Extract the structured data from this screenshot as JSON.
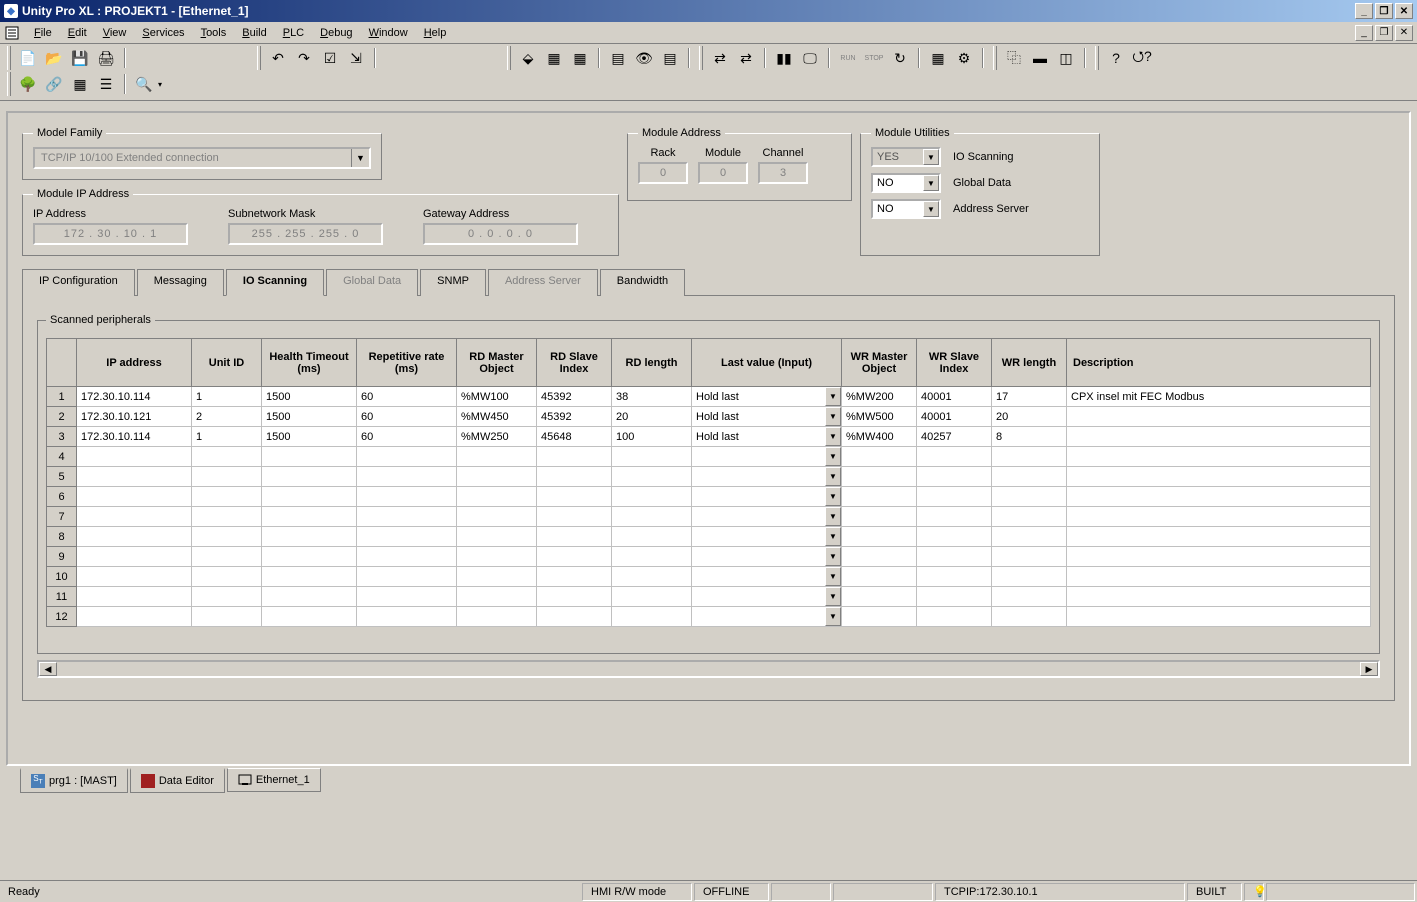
{
  "window": {
    "title": "Unity Pro XL : PROJEKT1 - [Ethernet_1]"
  },
  "menu": [
    "File",
    "Edit",
    "View",
    "Services",
    "Tools",
    "Build",
    "PLC",
    "Debug",
    "Window",
    "Help"
  ],
  "config": {
    "model_family": {
      "legend": "Model Family",
      "value": "TCP/IP 10/100 Extended connection"
    },
    "module_address": {
      "legend": "Module Address",
      "rack_label": "Rack",
      "rack": "0",
      "module_label": "Module",
      "module": "0",
      "channel_label": "Channel",
      "channel": "3"
    },
    "utilities": {
      "legend": "Module Utilities",
      "io_scanning": {
        "label": "IO Scanning",
        "value": "YES"
      },
      "global_data": {
        "label": "Global Data",
        "value": "NO"
      },
      "address_server": {
        "label": "Address Server",
        "value": "NO"
      }
    },
    "module_ip": {
      "legend": "Module IP Address",
      "ip_label": "IP Address",
      "ip": "172 . 30 . 10 . 1",
      "subnet_label": "Subnetwork Mask",
      "subnet": "255 . 255 . 255 . 0",
      "gateway_label": "Gateway Address",
      "gateway": "0 . 0 . 0 . 0"
    }
  },
  "tabs": {
    "ip_config": "IP Configuration",
    "messaging": "Messaging",
    "io_scanning": "IO Scanning",
    "global_data": "Global Data",
    "snmp": "SNMP",
    "address_server": "Address Server",
    "bandwidth": "Bandwidth"
  },
  "scan": {
    "legend": "Scanned peripherals",
    "headers": {
      "ip": "IP address",
      "unit": "Unit ID",
      "health": "Health Timeout (ms)",
      "rep": "Repetitive rate (ms)",
      "rdm": "RD Master Object",
      "rds": "RD Slave Index",
      "rdl": "RD length",
      "last": "Last value (Input)",
      "wrm": "WR Master Object",
      "wrs": "WR Slave Index",
      "wrl": "WR length",
      "desc": "Description"
    },
    "rows": [
      {
        "n": "1",
        "ip": "172.30.10.114",
        "unit": "1",
        "health": "1500",
        "rep": "60",
        "rdm": "%MW100",
        "rds": "45392",
        "rdl": "38",
        "last": "Hold last",
        "wrm": "%MW200",
        "wrs": "40001",
        "wrl": "17",
        "desc": "CPX insel mit FEC Modbus"
      },
      {
        "n": "2",
        "ip": "172.30.10.121",
        "unit": "2",
        "health": "1500",
        "rep": "60",
        "rdm": "%MW450",
        "rds": "45392",
        "rdl": "20",
        "last": "Hold last",
        "wrm": "%MW500",
        "wrs": "40001",
        "wrl": "20",
        "desc": ""
      },
      {
        "n": "3",
        "ip": "172.30.10.114",
        "unit": "1",
        "health": "1500",
        "rep": "60",
        "rdm": "%MW250",
        "rds": "45648",
        "rdl": "100",
        "last": "Hold last",
        "wrm": "%MW400",
        "wrs": "40257",
        "wrl": "8",
        "desc": ""
      }
    ],
    "empty_rows": [
      "4",
      "5",
      "6",
      "7",
      "8",
      "9",
      "10",
      "11",
      "12"
    ]
  },
  "bottom_tabs": {
    "prg1": "prg1 : [MAST]",
    "data_editor": "Data Editor",
    "ethernet": "Ethernet_1"
  },
  "status": {
    "ready": "Ready",
    "hmi": "HMI R/W mode",
    "offline": "OFFLINE",
    "tcpip": "TCPIP:172.30.10.1",
    "built": "BUILT"
  }
}
